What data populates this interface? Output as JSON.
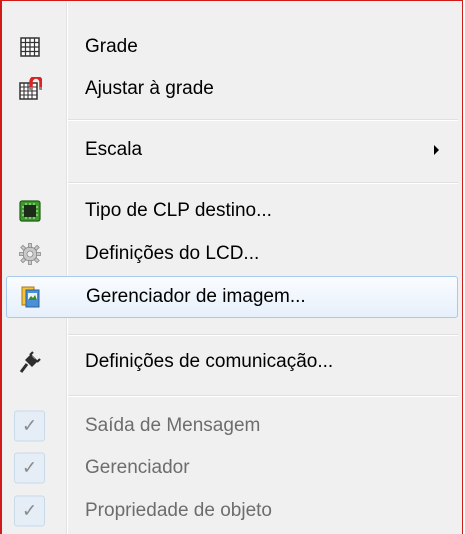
{
  "menu": {
    "items": [
      {
        "label": "Grade",
        "icon": "grid-icon"
      },
      {
        "label": "Ajustar à grade",
        "icon": "snap-to-grid-icon"
      },
      {
        "label": "Escala",
        "icon": "",
        "submenu": true
      },
      {
        "label": "Tipo de CLP destino...",
        "icon": "plc-chip-icon"
      },
      {
        "label": "Definições do LCD...",
        "icon": "gear-icon"
      },
      {
        "label": "Gerenciador de imagem...",
        "icon": "image-manager-icon"
      },
      {
        "label": "Definições de comunicação...",
        "icon": "plug-icon"
      },
      {
        "label": "Saída de Mensagem",
        "checked": true,
        "disabled": true
      },
      {
        "label": "Gerenciador",
        "checked": true,
        "disabled": true
      },
      {
        "label": "Propriedade de objeto",
        "checked": true,
        "disabled": true
      }
    ],
    "check_glyph": "✓"
  }
}
